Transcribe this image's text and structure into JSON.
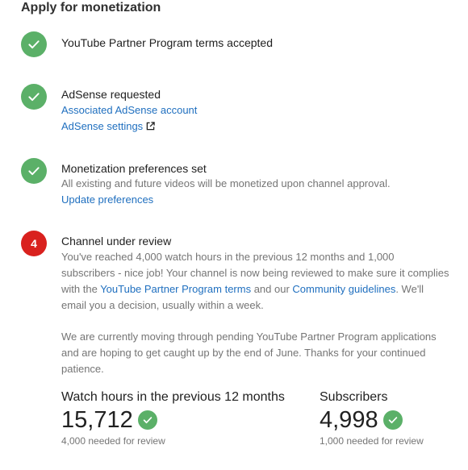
{
  "header": {
    "title": "Apply for monetization"
  },
  "steps": [
    {
      "status": "done",
      "title": "YouTube Partner Program terms accepted"
    },
    {
      "status": "done",
      "title": "AdSense requested",
      "link1": "Associated AdSense account",
      "link2": "AdSense settings"
    },
    {
      "status": "done",
      "title": "Monetization preferences set",
      "description": "All existing and future videos will be monetized upon channel approval.",
      "link1": "Update preferences"
    },
    {
      "status": "in-review",
      "number": "4",
      "title": "Channel under review",
      "para1_a": "You've reached 4,000 watch hours in the previous 12 months and 1,000 subscribers - nice job! Your channel is now being reviewed to make sure it complies with the ",
      "para1_link1": "YouTube Partner Program terms",
      "para1_b": " and our ",
      "para1_link2": "Community guidelines",
      "para1_c": ". We'll email you a decision, usually within a week.",
      "para2": "We are currently moving through pending YouTube Partner Program applications and are hoping to get caught up by the end of June. Thanks for your continued patience."
    }
  ],
  "stats": {
    "watch_hours": {
      "label": "Watch hours in the previous 12 months",
      "value": "15,712",
      "note": "4,000 needed for review"
    },
    "subscribers": {
      "label": "Subscribers",
      "value": "4,998",
      "note": "1,000 needed for review"
    }
  },
  "icons": {
    "check": "check-icon",
    "external": "external-link-icon"
  },
  "colors": {
    "success": "#5bb068",
    "alert": "#d9211e",
    "link": "#1f6fbf",
    "secondary_text": "#757575"
  }
}
